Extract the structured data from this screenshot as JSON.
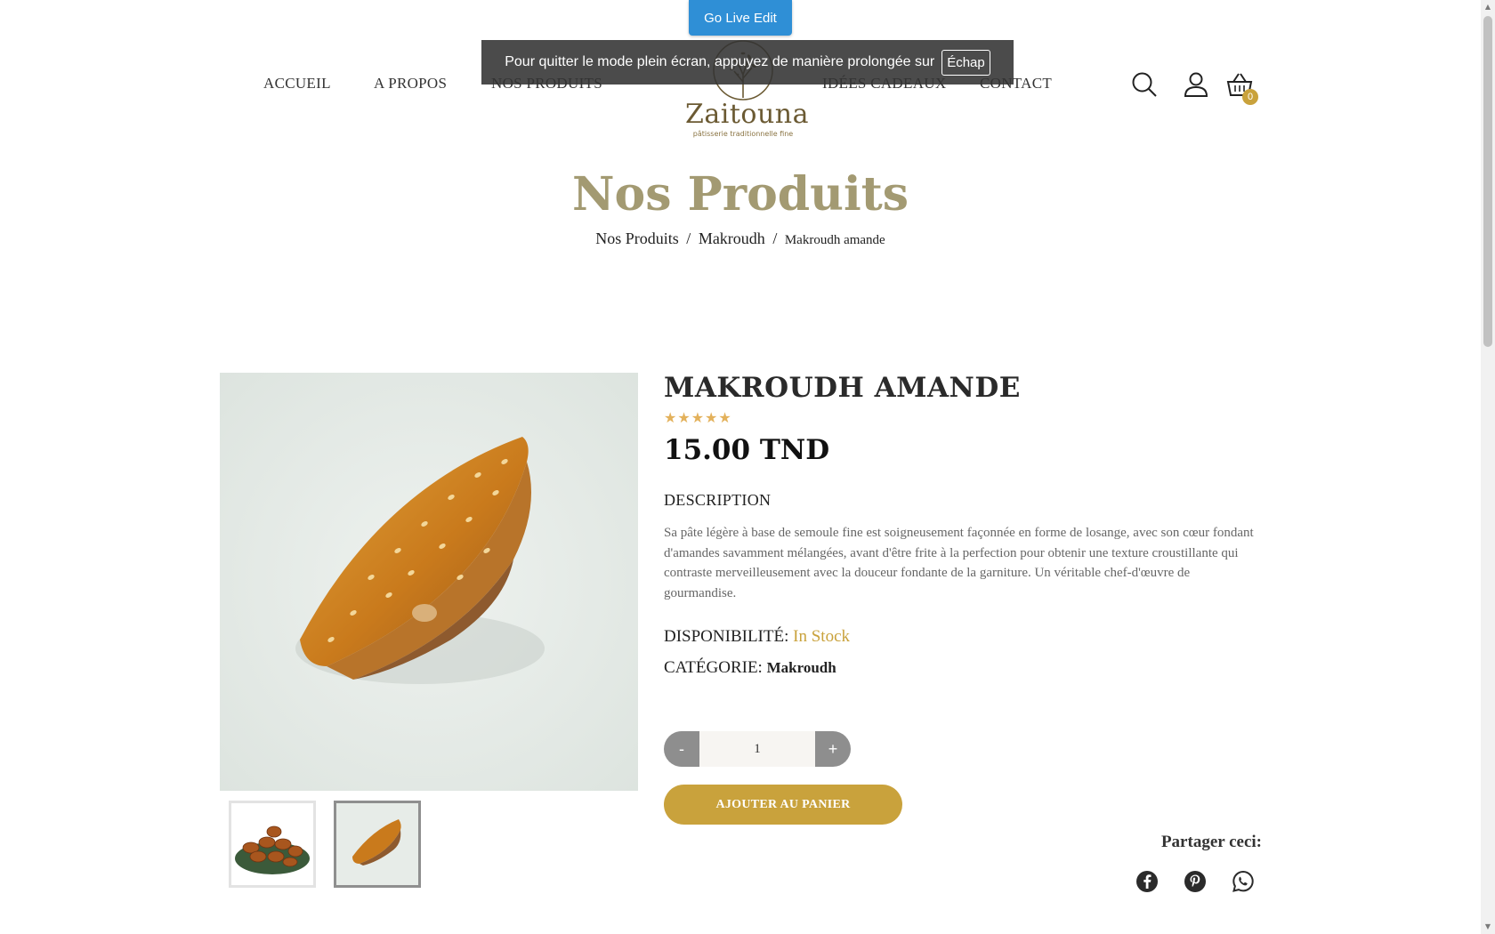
{
  "overlay": {
    "go_live_label": "Go Live Edit",
    "fullscreen_notice": "Pour quitter le mode plein écran, appuyez de manière prolongée sur",
    "fullscreen_key": "Échap"
  },
  "header": {
    "nav": [
      "ACCUEIL",
      "A PROPOS",
      "NOS PRODUITS",
      "IDÉES CADEAUX",
      "CONTACT"
    ],
    "logo": {
      "name": "Zaitouna",
      "tagline": "pâtisserie traditionnelle fine"
    },
    "icons": [
      "search-icon",
      "user-icon",
      "basket-icon"
    ],
    "cart_count": "0"
  },
  "page": {
    "title": "Nos Produits",
    "breadcrumb": [
      "Nos Produits",
      "Makroudh",
      "Makroudh amande"
    ],
    "breadcrumb_sep": "/"
  },
  "product": {
    "name": "MAKROUDH AMANDE",
    "rating": 5,
    "stars": "★★★★★",
    "price": "15.00 TND",
    "description_heading": "DESCRIPTION",
    "description": "Sa pâte légère à base de semoule fine est soigneusement façonnée en forme de losange, avec son cœur fondant d'amandes savamment mélangées, avant d'être frite à la perfection pour obtenir une texture croustillante qui contraste merveilleusement avec la douceur fondante de la garniture. Un véritable chef-d'œuvre de gourmandise.",
    "availability_label": "DISPONIBILITÉ:",
    "availability_value": "In Stock",
    "category_label": "CATÉGORIE:",
    "category_value": "Makroudh",
    "quantity": "1",
    "qty_minus": "-",
    "qty_plus": "+",
    "add_to_cart": "AJOUTER AU PANIER",
    "share_label": "Partager ceci:",
    "share_icons": [
      "facebook-icon",
      "pinterest-icon",
      "whatsapp-icon"
    ]
  },
  "colors": {
    "accent_gold": "#c9a23c",
    "title_color": "#a39a72",
    "go_live_blue": "#2f8fd6"
  }
}
